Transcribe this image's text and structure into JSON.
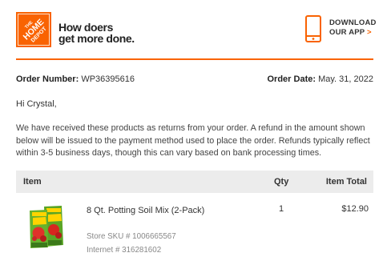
{
  "header": {
    "logo_text": "THE HOME DEPOT",
    "tagline_line1": "How doers",
    "tagline_line2": "get more done.",
    "app_line1": "DOWNLOAD",
    "app_line2": "OUR APP",
    "app_chevron": ">",
    "icons": [
      "phone-icon"
    ]
  },
  "order": {
    "number_label": "Order Number:",
    "number_value": "WP36395616",
    "date_label": "Order Date:",
    "date_value": "May. 31, 2022"
  },
  "greeting": "Hi Crystal,",
  "message": "We have received these products as returns from your order. A refund in the amount shown below will be issued to the payment method used to place the order. Refunds typically reflect within 3-5 business days, though this can vary based on bank processing times.",
  "table": {
    "headers": {
      "item": "Item",
      "qty": "Qty",
      "total": "Item Total"
    },
    "rows": [
      {
        "name": "8 Qt. Potting Soil Mix (2-Pack)",
        "qty": "1",
        "total": "$12.90",
        "sku": "Store SKU # 1006665567",
        "internet": "Internet # 316281602"
      }
    ]
  },
  "colors": {
    "brand": "#f96302",
    "table_header_bg": "#ececec"
  }
}
